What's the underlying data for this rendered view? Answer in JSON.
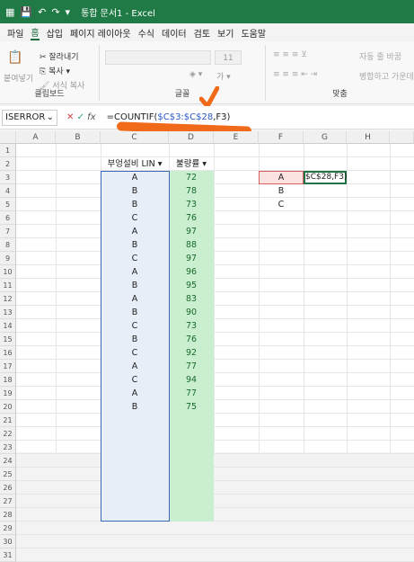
{
  "titlebar": {
    "title": "통합 문서1 - Excel",
    "icons": [
      "excel-icon",
      "save-icon",
      "undo-icon",
      "redo-icon",
      "customize-icon"
    ]
  },
  "menu": [
    "파일",
    "홈",
    "삽입",
    "페이지 레이아웃",
    "수식",
    "데이터",
    "검토",
    "보기",
    "도움말"
  ],
  "ribbon": {
    "paste": "붙여넣기",
    "cut": "잘라내기",
    "copy": "복사",
    "format_painter": "서식 복사",
    "clipboard_label": "클립보드",
    "font_size": "11",
    "font_label": "글꼴",
    "wrap_text": "자동 줄 바꿈",
    "merge": "병합하고 가운데",
    "align_label": "맞춤"
  },
  "formula_bar": {
    "namebox": "ISERROR",
    "fx": "fx",
    "formula_prefix": "=COUNTIF(",
    "formula_range": "$C$3:$C$28",
    "formula_suffix": ",F3)"
  },
  "columns": [
    "A",
    "B",
    "C",
    "D",
    "E",
    "F",
    "G",
    "H"
  ],
  "rows": [
    "1",
    "2",
    "3",
    "4",
    "5",
    "6",
    "7",
    "8",
    "9",
    "10",
    "11",
    "12",
    "13",
    "14",
    "15",
    "16",
    "17",
    "18",
    "19",
    "20",
    "21",
    "22",
    "23",
    "24",
    "25",
    "26",
    "27",
    "28",
    "29",
    "30",
    "31"
  ],
  "headers": {
    "c2": "부엉설비 LIN",
    "d2": "불량률"
  },
  "col_c": [
    "A",
    "B",
    "B",
    "C",
    "A",
    "B",
    "C",
    "A",
    "B",
    "A",
    "B",
    "C",
    "B",
    "C",
    "A",
    "C",
    "A",
    "B"
  ],
  "col_d": [
    "72",
    "78",
    "73",
    "76",
    "97",
    "88",
    "97",
    "96",
    "95",
    "83",
    "90",
    "73",
    "76",
    "92",
    "77",
    "94",
    "77",
    "75"
  ],
  "f_values": [
    "A",
    "B",
    "C"
  ],
  "g3": "$C$28,F3)",
  "colors": {
    "accent": "#217346",
    "orange": "#f06a1a"
  }
}
